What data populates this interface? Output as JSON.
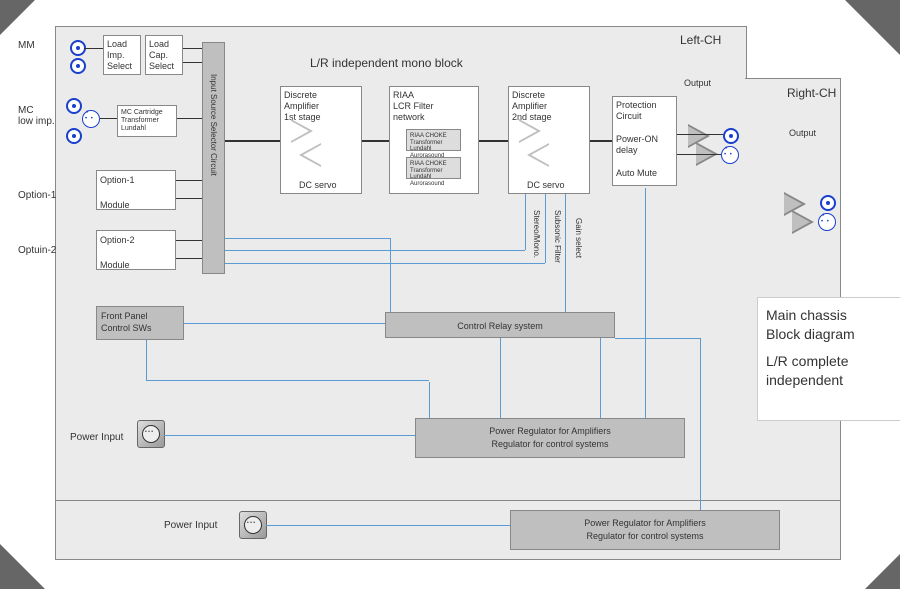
{
  "header": {
    "left_ch": "Left-CH",
    "right_ch": "Right-CH",
    "title": "L/R independent mono block",
    "output": "Output",
    "output2": "Output"
  },
  "inputs": {
    "mm": "MM",
    "mc": "MC\nlow imp.",
    "opt1": "Option-1",
    "opt2": "Optuin-2",
    "pwr1": "Power Input",
    "pwr2": "Power Input"
  },
  "blk": {
    "load_imp": "Load\nImp.\nSelect",
    "load_cap": "Load\nCap.\nSelect",
    "mc_cart": "MC Cartridge\nTransformer\nLundahl",
    "opt1m": "Option-1\n\nModule",
    "opt2m": "Option-2\n\nModule",
    "selector": "Input Source Selector Circuit",
    "amp1": "Discrete\nAmplifier\n1st stage",
    "dc1": "DC servo",
    "riaa": "RIAA\nLCR Filter\nnetwork",
    "choke": "RIAA CHOKE\nTransformer\nLundahl\nAurorasound",
    "amp2": "Discrete\nAmplifier\n2nd stage",
    "dc2": "DC servo",
    "prot": "Protection\nCircuit\n\nPower-ON\ndelay\n\nAuto Mute",
    "fp": "Front Panel\nControl SWs",
    "relay": "Control Relay system",
    "reg1": "Power Regulator for Amplifiers\nRegulator for control systems",
    "reg2": "Power Regulator for Amplifiers\nRegulator for control systems",
    "v1": "Stereo/Mono.",
    "v2": "Subsonic Filter",
    "v3": "Gain select"
  },
  "note": {
    "l1": "Main chassis",
    "l2": "Block diagram",
    "l3": "L/R complete",
    "l4": "independent"
  }
}
